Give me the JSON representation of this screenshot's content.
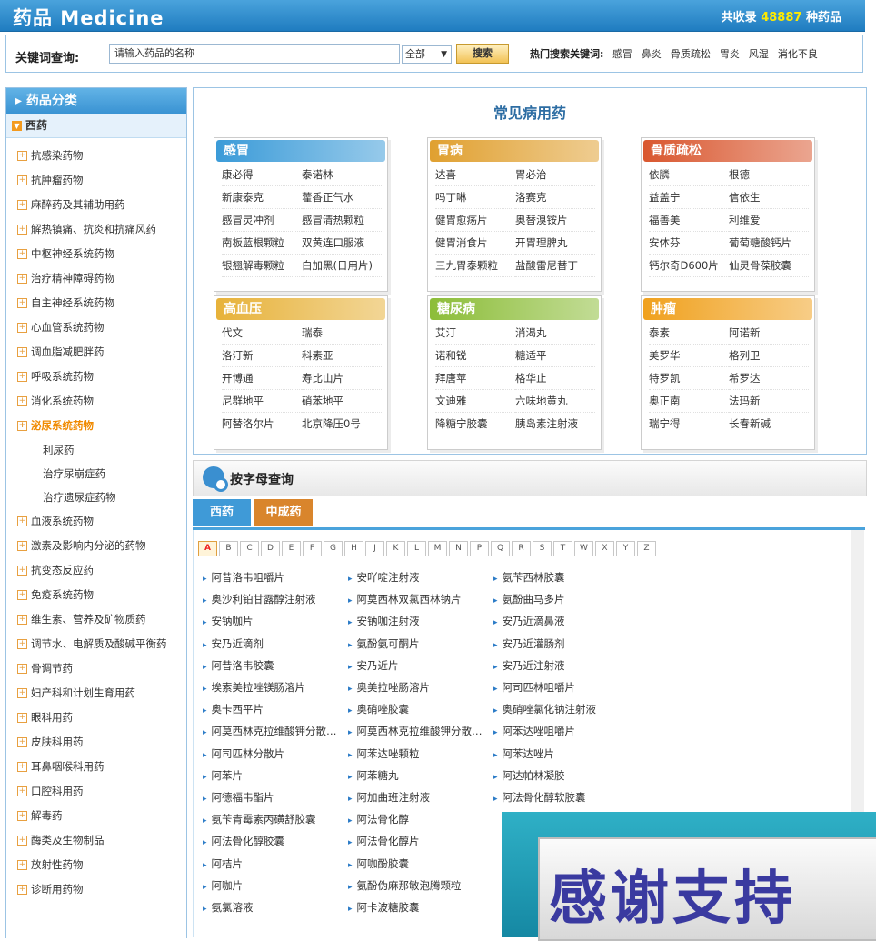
{
  "header": {
    "logo": "药品 Medicine",
    "total_prefix": "共收录",
    "total_num": "48887",
    "total_suffix": "种药品"
  },
  "search": {
    "label": "关键词查询:",
    "placeholder": "请输入药品的名称",
    "select": "全部",
    "button": "搜索",
    "hot_label": "热门搜索关键词:",
    "hot": [
      "感冒",
      "鼻炎",
      "骨质疏松",
      "胃炎",
      "风湿",
      "消化不良"
    ]
  },
  "sidebar": {
    "title": "药品分类",
    "category": "西药",
    "items": [
      "抗感染药物",
      "抗肿瘤药物",
      "麻醉药及其辅助用药",
      "解热镇痛、抗炎和抗痛风药",
      "中枢神经系统药物",
      "治疗精神障碍药物",
      "自主神经系统药物",
      "心血管系统药物",
      "调血脂减肥胖药",
      "呼吸系统药物",
      "消化系统药物",
      "泌尿系统药物"
    ],
    "subitems": [
      "利尿药",
      "治疗尿崩症药",
      "治疗遗尿症药物"
    ],
    "items2": [
      "血液系统药物",
      "激素及影响内分泌的药物",
      "抗变态反应药",
      "免疫系统药物",
      "维生素、营养及矿物质药",
      "调节水、电解质及酸碱平衡药",
      "骨调节药",
      "妇产科和计划生育用药",
      "眼科用药",
      "皮肤科用药",
      "耳鼻咽喉科用药",
      "口腔科用药",
      "解毒药",
      "酶类及生物制品",
      "放射性药物",
      "诊断用药物"
    ]
  },
  "main": {
    "title": "常见病用药",
    "boxes": [
      {
        "title": "感冒",
        "color": "#3b9bd8",
        "items": [
          "康必得",
          "泰诺林",
          "新康泰克",
          "藿香正气水",
          "感冒灵冲剂",
          "感冒清热颗粒",
          "南板蓝根颗粒",
          "双黄连口服液",
          "银翘解毒颗粒",
          "白加黑(日用片)"
        ]
      },
      {
        "title": "胃病",
        "color": "#e0a030",
        "items": [
          "达喜",
          "胃必治",
          "吗丁啉",
          "洛赛克",
          "健胃愈疡片",
          "奥替溴铵片",
          "健胃消食片",
          "开胃理脾丸",
          "三九胃泰颗粒",
          "盐酸雷尼替丁"
        ]
      },
      {
        "title": "骨质疏松",
        "color": "#d9572f",
        "items": [
          "依膦",
          "根德",
          "益盖宁",
          "信依生",
          "福善美",
          "利维爱",
          "安体芬",
          "葡萄糖酸钙片",
          "钙尔奇D600片",
          "仙灵骨葆胶囊"
        ]
      },
      {
        "title": "高血压",
        "color": "#e7b23a",
        "items": [
          "代文",
          "瑞泰",
          "洛汀新",
          "科素亚",
          "开博通",
          "寿比山片",
          "尼群地平",
          "硝苯地平",
          "阿替洛尔片",
          "北京降压0号"
        ]
      },
      {
        "title": "糖尿病",
        "color": "#8cbd38",
        "items": [
          "艾汀",
          "消渴丸",
          "诺和锐",
          "糖适平",
          "拜唐苹",
          "格华止",
          "文迪雅",
          "六味地黄丸",
          "降糖宁胶囊",
          "胰岛素注射液"
        ]
      },
      {
        "title": "肿瘤",
        "color": "#f0a11e",
        "items": [
          "泰素",
          "阿诺新",
          "美罗华",
          "格列卫",
          "特罗凯",
          "希罗达",
          "奥正南",
          "法玛新",
          "瑞宁得",
          "长春新碱"
        ]
      }
    ]
  },
  "alpha_section": {
    "title": "按字母查询",
    "tabs": [
      "西药",
      "中成药"
    ],
    "letters": [
      "A",
      "B",
      "C",
      "D",
      "E",
      "F",
      "G",
      "H",
      "J",
      "K",
      "L",
      "M",
      "N",
      "P",
      "Q",
      "R",
      "S",
      "T",
      "W",
      "X",
      "Y",
      "Z"
    ],
    "drugs": [
      [
        "阿昔洛韦咀嚼片",
        "安吖啶注射液",
        "氨苄西林胶囊"
      ],
      [
        "奥沙利铂甘露醇注射液",
        "阿莫西林双氯西林钠片",
        "氨酚曲马多片"
      ],
      [
        "安钠咖片",
        "安钠咖注射液",
        "安乃近滴鼻液"
      ],
      [
        "安乃近滴剂",
        "氨酚氨可酮片",
        "安乃近灌肠剂"
      ],
      [
        "阿昔洛韦胶囊",
        "安乃近片",
        "安乃近注射液"
      ],
      [
        "埃索美拉唑镁肠溶片",
        "奥美拉唑肠溶片",
        "阿司匹林咀嚼片"
      ],
      [
        "奥卡西平片",
        "奥硝唑胶囊",
        "奥硝唑氯化钠注射液"
      ],
      [
        "阿莫西林克拉维酸钾分散…",
        "阿莫西林克拉维酸钾分散…",
        "阿苯达唑咀嚼片"
      ],
      [
        "阿司匹林分散片",
        "阿苯达唑颗粒",
        "阿苯达唑片"
      ],
      [
        "阿苯片",
        "阿苯糖丸",
        "阿达帕林凝胶"
      ],
      [
        "阿德福韦酯片",
        "阿加曲班注射液",
        "阿法骨化醇软胶囊"
      ],
      [
        "氨苄青霉素丙磺舒胶囊",
        "阿法骨化醇",
        ""
      ],
      [
        "阿法骨化醇胶囊",
        "阿法骨化醇片",
        ""
      ],
      [
        "阿桔片",
        "阿咖酚胶囊",
        ""
      ],
      [
        "阿咖片",
        "氨酚伪麻那敏泡腾颗粒",
        ""
      ],
      [
        "氨氯溶液",
        "阿卡波糖胶囊",
        ""
      ]
    ]
  },
  "overlay": {
    "text": "感谢支持"
  }
}
